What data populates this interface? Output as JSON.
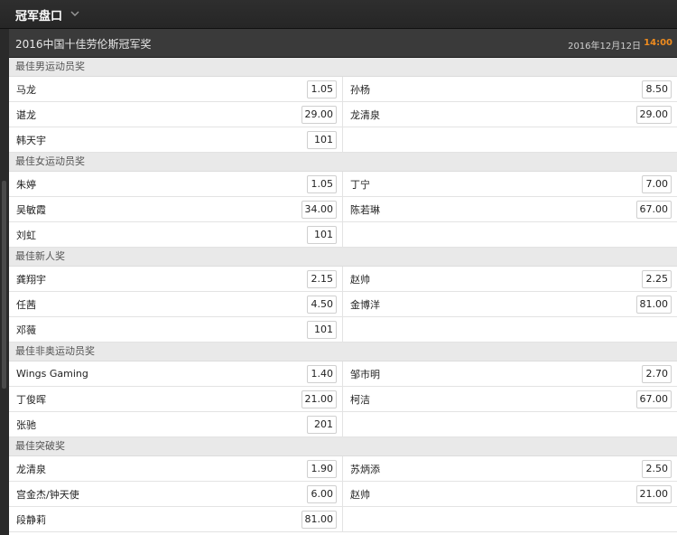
{
  "header": {
    "title": "冠军盘口"
  },
  "event": {
    "name": "2016中国十佳劳伦斯冠军奖",
    "date": "2016年12月12日",
    "time": "14:00"
  },
  "sections": [
    {
      "title": "最佳男运动员奖",
      "rows": [
        {
          "left": {
            "name": "马龙",
            "odds": "1.05"
          },
          "right": {
            "name": "孙杨",
            "odds": "8.50"
          }
        },
        {
          "left": {
            "name": "谌龙",
            "odds": "29.00"
          },
          "right": {
            "name": "龙清泉",
            "odds": "29.00"
          }
        },
        {
          "left": {
            "name": "韩天宇",
            "odds": "101"
          },
          "right": null
        }
      ]
    },
    {
      "title": "最佳女运动员奖",
      "rows": [
        {
          "left": {
            "name": "朱婷",
            "odds": "1.05"
          },
          "right": {
            "name": "丁宁",
            "odds": "7.00"
          }
        },
        {
          "left": {
            "name": "吴敏霞",
            "odds": "34.00"
          },
          "right": {
            "name": "陈若琳",
            "odds": "67.00"
          }
        },
        {
          "left": {
            "name": "刘虹",
            "odds": "101"
          },
          "right": null
        }
      ]
    },
    {
      "title": "最佳新人奖",
      "rows": [
        {
          "left": {
            "name": "龚翔宇",
            "odds": "2.15"
          },
          "right": {
            "name": "赵帅",
            "odds": "2.25"
          }
        },
        {
          "left": {
            "name": "任茜",
            "odds": "4.50"
          },
          "right": {
            "name": "金博洋",
            "odds": "81.00"
          }
        },
        {
          "left": {
            "name": "邓薇",
            "odds": "101"
          },
          "right": null
        }
      ]
    },
    {
      "title": "最佳非奥运动员奖",
      "rows": [
        {
          "left": {
            "name": "Wings Gaming",
            "odds": "1.40"
          },
          "right": {
            "name": "邹市明",
            "odds": "2.70"
          }
        },
        {
          "left": {
            "name": "丁俊晖",
            "odds": "21.00"
          },
          "right": {
            "name": "柯洁",
            "odds": "67.00"
          }
        },
        {
          "left": {
            "name": "张驰",
            "odds": "201"
          },
          "right": null
        }
      ]
    },
    {
      "title": "最佳突破奖",
      "rows": [
        {
          "left": {
            "name": "龙清泉",
            "odds": "1.90"
          },
          "right": {
            "name": "苏炳添",
            "odds": "2.50"
          }
        },
        {
          "left": {
            "name": "宫金杰/钟天使",
            "odds": "6.00"
          },
          "right": {
            "name": "赵帅",
            "odds": "21.00"
          }
        },
        {
          "left": {
            "name": "段静莉",
            "odds": "81.00"
          },
          "right": null
        }
      ]
    }
  ]
}
